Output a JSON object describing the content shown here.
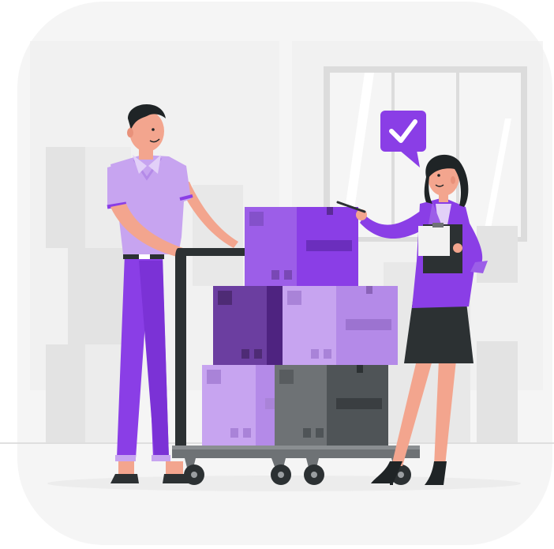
{
  "illustration": {
    "subject": "",
    "palette": {
      "accent": "#8a3ee6",
      "accent_light": "#c7a4f0",
      "accent_mid": "#9c5ee8",
      "accent_dark": "#6b3ea0",
      "dark": "#2c3133",
      "grey_box": "#6e7275",
      "background_card": "#f5f5f5",
      "background_shapes": "#e6e6e6",
      "skin": "#f3a58e",
      "hair": "#1f2426"
    },
    "icons": [
      "check-speech-bubble-icon",
      "clipboard-icon",
      "pen-icon"
    ]
  }
}
